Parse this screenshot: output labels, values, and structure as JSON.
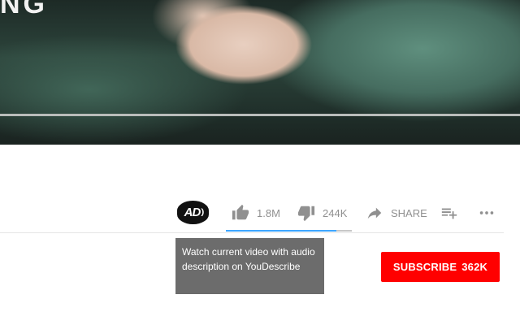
{
  "video": {
    "overlay_text": "NG"
  },
  "actions": {
    "audio_description_label": "AD",
    "like_count": "1.8M",
    "dislike_count": "244K",
    "share_label": "SHARE",
    "like_ratio": 0.88,
    "icons": {
      "audio_description": "audio-description-icon",
      "like": "thumbs-up-icon",
      "dislike": "thumbs-down-icon",
      "share": "share-arrow-icon",
      "save": "playlist-add-icon",
      "more": "more-horizontal-icon"
    }
  },
  "tooltip": {
    "text": "Watch current video with audio description on YouDescribe"
  },
  "subscribe": {
    "label": "SUBSCRIBE",
    "count": "362K",
    "color": "#ff0000"
  },
  "colors": {
    "icon_gray": "#909090",
    "like_bar": "#3ea6ff",
    "tooltip_bg": "#6c6c6c"
  }
}
